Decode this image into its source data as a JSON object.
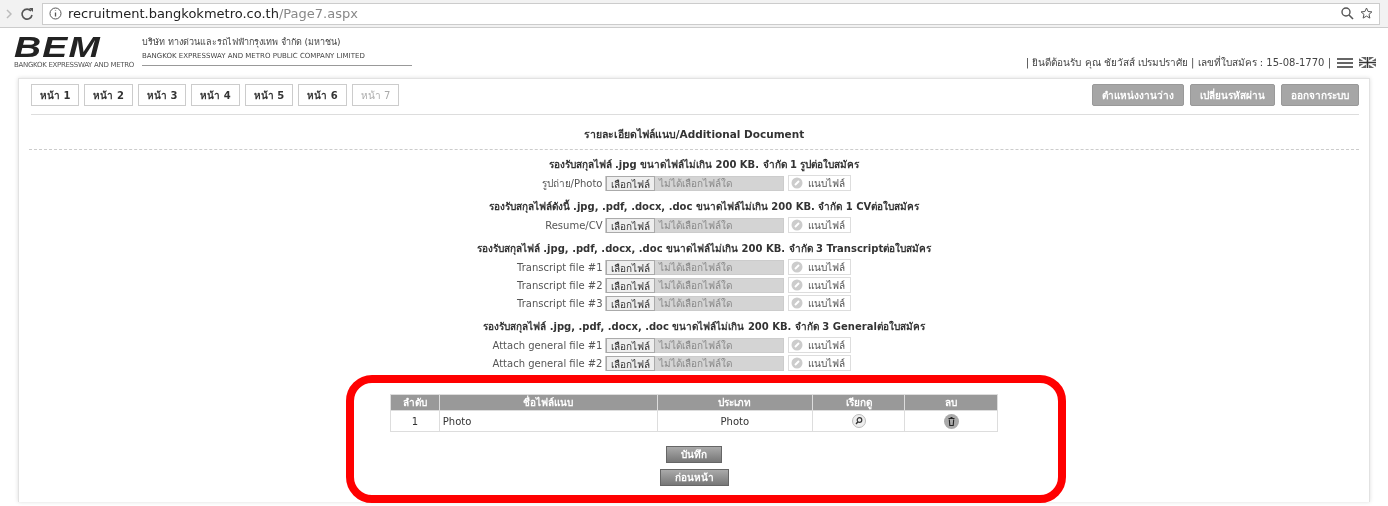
{
  "browser": {
    "url_host": "recruitment.bangkokmetro.co.th",
    "url_path": "/Page7.aspx"
  },
  "header": {
    "logo": "BEM",
    "logo_caption": "BANGKOK EXPRESSWAY AND METRO",
    "company_th": "บริษัท ทางด่วนและรถไฟฟ้ากรุงเทพ จำกัด (มหาชน)",
    "company_en": "BANGKOK EXPRESSWAY AND METRO PUBLIC COMPANY LIMITED",
    "user_info": "| ยินดีต้อนรับ คุณ ชัยวัสส์ เปรมปราศัย | เลขที่ใบสมัคร : 15-08-1770 |"
  },
  "tabs": [
    {
      "label": "หน้า 1",
      "disabled": false
    },
    {
      "label": "หน้า 2",
      "disabled": false
    },
    {
      "label": "หน้า 3",
      "disabled": false
    },
    {
      "label": "หน้า 4",
      "disabled": false
    },
    {
      "label": "หน้า 5",
      "disabled": false
    },
    {
      "label": "หน้า 6",
      "disabled": false
    },
    {
      "label": "หน้า 7",
      "disabled": true
    }
  ],
  "actions": [
    "ตำแหน่งงานว่าง",
    "เปลี่ยนรหัสผ่าน",
    "ออกจากระบบ"
  ],
  "title": "รายละเอียดไฟล์แนบ/Additional Document",
  "sections": [
    {
      "heading": "รองรับสกุลไฟล์ .jpg ขนาดไฟล์ไม่เกิน 200 KB. จำกัด 1 รูปต่อใบสมัคร",
      "rows": [
        {
          "label": "รูปถ่าย/Photo",
          "choose": "เลือกไฟล์",
          "placeholder": "ไม่ได้เลือกไฟล์ใด",
          "attach": "แนบไฟล์"
        }
      ]
    },
    {
      "heading": "รองรับสกุลไฟล์ดังนี้ .jpg, .pdf, .docx, .doc ขนาดไฟล์ไม่เกิน 200 KB. จำกัด 1 CVต่อใบสมัคร",
      "rows": [
        {
          "label": "Resume/CV",
          "choose": "เลือกไฟล์",
          "placeholder": "ไม่ได้เลือกไฟล์ใด",
          "attach": "แนบไฟล์"
        }
      ]
    },
    {
      "heading": "รองรับสกุลไฟล์ .jpg, .pdf, .docx, .doc ขนาดไฟล์ไม่เกิน 200 KB. จำกัด 3 Transcriptต่อใบสมัคร",
      "rows": [
        {
          "label": "Transcript file #1",
          "choose": "เลือกไฟล์",
          "placeholder": "ไม่ได้เลือกไฟล์ใด",
          "attach": "แนบไฟล์"
        },
        {
          "label": "Transcript file #2",
          "choose": "เลือกไฟล์",
          "placeholder": "ไม่ได้เลือกไฟล์ใด",
          "attach": "แนบไฟล์"
        },
        {
          "label": "Transcript file #3",
          "choose": "เลือกไฟล์",
          "placeholder": "ไม่ได้เลือกไฟล์ใด",
          "attach": "แนบไฟล์"
        }
      ]
    },
    {
      "heading": "รองรับสกุลไฟล์ .jpg, .pdf, .docx, .doc ขนาดไฟล์ไม่เกิน 200 KB. จำกัด 3 Generalต่อใบสมัคร",
      "rows": [
        {
          "label": "Attach general file #1",
          "choose": "เลือกไฟล์",
          "placeholder": "ไม่ได้เลือกไฟล์ใด",
          "attach": "แนบไฟล์"
        },
        {
          "label": "Attach general file #2",
          "choose": "เลือกไฟล์",
          "placeholder": "ไม่ได้เลือกไฟล์ใด",
          "attach": "แนบไฟล์"
        }
      ]
    }
  ],
  "table": {
    "columns": [
      "ลำดับ",
      "ชื่อไฟล์แนบ",
      "ประเภท",
      "เรียกดู",
      "ลบ"
    ],
    "rows": [
      {
        "no": "1",
        "name": "Photo",
        "type": "Photo"
      }
    ]
  },
  "buttons": [
    "บันทึก",
    "ก่อนหน้า"
  ]
}
